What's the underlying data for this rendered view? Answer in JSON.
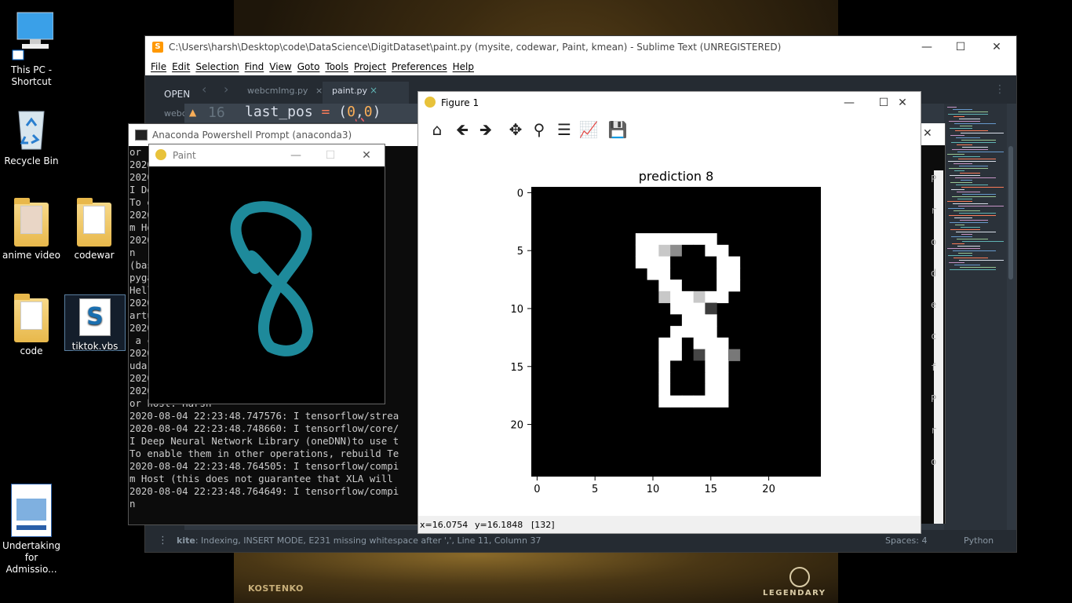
{
  "desktop": {
    "icons": [
      {
        "label": "This PC -\nShortcut",
        "name": "this-pc-shortcut"
      },
      {
        "label": "Recycle Bin",
        "name": "recycle-bin"
      },
      {
        "label": "anime video",
        "name": "anime-video-folder"
      },
      {
        "label": "codewar",
        "name": "codewar-folder"
      },
      {
        "label": "code",
        "name": "code-folder"
      },
      {
        "label": "tiktok.vbs",
        "name": "tiktok-vbs"
      },
      {
        "label": "Undertaking\nfor Admissio...",
        "name": "undertaking-document"
      }
    ],
    "wallpaper_texts": {
      "left": "KOSTENKO",
      "right": "LEGENDARY"
    }
  },
  "sublime": {
    "title": "C:\\Users\\harsh\\Desktop\\code\\DataScience\\DigitDataset\\paint.py (mysite, codewar, Paint, kmean) - Sublime Text (UNREGISTERED)",
    "menu": [
      "File",
      "Edit",
      "Selection",
      "Find",
      "View",
      "Goto",
      "Tools",
      "Project",
      "Preferences",
      "Help"
    ],
    "sidebar_header": "OPEN",
    "sidebar_file": "webc",
    "tabs": [
      {
        "label": "webcmImg.py",
        "close": "×"
      },
      {
        "label": "paint.py",
        "close": "×"
      }
    ],
    "line_number": "16",
    "code_line": {
      "a": "last_pos",
      "b": " = ",
      "c": "(",
      "d": "0",
      "e": ",",
      "f": "0",
      "g": ")"
    },
    "status": {
      "linter": "kite",
      "message": ": Indexing, INSERT MODE, E231 missing whitespace after ',', Line 11, Column 37",
      "spaces": "Spaces: 4",
      "syntax": "Python"
    },
    "right_edge_letters": [
      "P",
      "r",
      "o",
      "d",
      "e",
      "c",
      "f",
      "P",
      "r",
      "o"
    ]
  },
  "anaconda": {
    "title": "Anaconda Powershell Prompt (anaconda3)",
    "lines": [
      "or",
      "2020                               strea",
      "2020                               core/",
      "I De                               use t",
      "To e                               ld Te",
      "2020                               compi",
      "m Ho                               will",
      "2020                               compi",
      "n",
      "(bas                               aScie",
      "pyga",
      "Hell                               www.p",
      "2020                               strea",
      "artu                                not",
      "2020                               strea",
      " a c",
      "2020                               strea",
      "udar",
      "2020                               strea",
      "2020                               strea",
      "or host: Harsh",
      "2020-08-04 22:23:48.747576: I tensorflow/strea",
      "2020-08-04 22:23:48.748660: I tensorflow/core/",
      "I Deep Neural Network Library (oneDNN)to use t",
      "To enable them in other operations, rebuild Te",
      "2020-08-04 22:23:48.764505: I tensorflow/compi",
      "m Host (this does not guarantee that XLA will",
      "2020-08-04 22:23:48.764649: I tensorflow/compi",
      "n"
    ]
  },
  "paint": {
    "title": "Paint",
    "stroke_color": "#1e8a9b"
  },
  "figure": {
    "title": "Figure 1",
    "toolbar": [
      "home-icon",
      "back-arrow-icon",
      "forward-arrow-icon",
      "pan-icon",
      "zoom-icon",
      "configure-subplots-icon",
      "edit-axis-icon",
      "save-icon"
    ],
    "status": {
      "x": "x=16.0754",
      "y": "y=16.1848",
      "value": "[132]"
    }
  },
  "chart_data": {
    "type": "heatmap",
    "title": "prediction 8",
    "xlabel": "",
    "ylabel": "",
    "xlim": [
      -0.5,
      24.5
    ],
    "ylim": [
      24.5,
      -0.5
    ],
    "xticks": [
      0,
      5,
      10,
      15,
      20
    ],
    "yticks": [
      0,
      5,
      10,
      15,
      20
    ],
    "colormap": "gray",
    "rows": 25,
    "cols": 25,
    "cells": [
      [
        9,
        4,
        255
      ],
      [
        10,
        4,
        255
      ],
      [
        11,
        4,
        255
      ],
      [
        12,
        4,
        255
      ],
      [
        13,
        4,
        255
      ],
      [
        14,
        4,
        255
      ],
      [
        15,
        4,
        255
      ],
      [
        9,
        5,
        255
      ],
      [
        10,
        5,
        255
      ],
      [
        11,
        5,
        200
      ],
      [
        12,
        5,
        140
      ],
      [
        13,
        5,
        0
      ],
      [
        14,
        5,
        0
      ],
      [
        15,
        5,
        255
      ],
      [
        16,
        5,
        255
      ],
      [
        9,
        6,
        255
      ],
      [
        10,
        6,
        255
      ],
      [
        11,
        6,
        255
      ],
      [
        12,
        6,
        0
      ],
      [
        13,
        6,
        0
      ],
      [
        14,
        6,
        0
      ],
      [
        15,
        6,
        0
      ],
      [
        16,
        6,
        255
      ],
      [
        17,
        6,
        255
      ],
      [
        10,
        7,
        255
      ],
      [
        11,
        7,
        255
      ],
      [
        12,
        7,
        0
      ],
      [
        13,
        7,
        0
      ],
      [
        14,
        7,
        0
      ],
      [
        15,
        7,
        0
      ],
      [
        16,
        7,
        255
      ],
      [
        17,
        7,
        255
      ],
      [
        11,
        8,
        255
      ],
      [
        12,
        8,
        255
      ],
      [
        13,
        8,
        0
      ],
      [
        14,
        8,
        0
      ],
      [
        15,
        8,
        0
      ],
      [
        16,
        8,
        255
      ],
      [
        17,
        8,
        255
      ],
      [
        11,
        9,
        200
      ],
      [
        12,
        9,
        255
      ],
      [
        13,
        9,
        255
      ],
      [
        14,
        9,
        200
      ],
      [
        15,
        9,
        255
      ],
      [
        16,
        9,
        255
      ],
      [
        12,
        10,
        255
      ],
      [
        13,
        10,
        255
      ],
      [
        14,
        10,
        255
      ],
      [
        15,
        10,
        60
      ],
      [
        12,
        11,
        0
      ],
      [
        13,
        11,
        255
      ],
      [
        14,
        11,
        255
      ],
      [
        15,
        11,
        255
      ],
      [
        12,
        12,
        255
      ],
      [
        13,
        12,
        255
      ],
      [
        14,
        12,
        255
      ],
      [
        15,
        12,
        255
      ],
      [
        11,
        13,
        255
      ],
      [
        12,
        13,
        255
      ],
      [
        13,
        13,
        0
      ],
      [
        14,
        13,
        255
      ],
      [
        15,
        13,
        255
      ],
      [
        16,
        13,
        255
      ],
      [
        11,
        14,
        255
      ],
      [
        12,
        14,
        255
      ],
      [
        13,
        14,
        0
      ],
      [
        14,
        14,
        70
      ],
      [
        15,
        14,
        255
      ],
      [
        16,
        14,
        255
      ],
      [
        17,
        14,
        120
      ],
      [
        11,
        15,
        255
      ],
      [
        12,
        15,
        0
      ],
      [
        13,
        15,
        0
      ],
      [
        14,
        15,
        0
      ],
      [
        15,
        15,
        255
      ],
      [
        16,
        15,
        255
      ],
      [
        11,
        16,
        255
      ],
      [
        12,
        16,
        0
      ],
      [
        13,
        16,
        0
      ],
      [
        14,
        16,
        0
      ],
      [
        15,
        16,
        255
      ],
      [
        16,
        16,
        255
      ],
      [
        11,
        17,
        255
      ],
      [
        12,
        17,
        0
      ],
      [
        13,
        17,
        0
      ],
      [
        14,
        17,
        0
      ],
      [
        15,
        17,
        255
      ],
      [
        16,
        17,
        255
      ],
      [
        11,
        18,
        255
      ],
      [
        12,
        18,
        255
      ],
      [
        13,
        18,
        255
      ],
      [
        14,
        18,
        255
      ],
      [
        15,
        18,
        255
      ],
      [
        16,
        18,
        255
      ]
    ]
  }
}
